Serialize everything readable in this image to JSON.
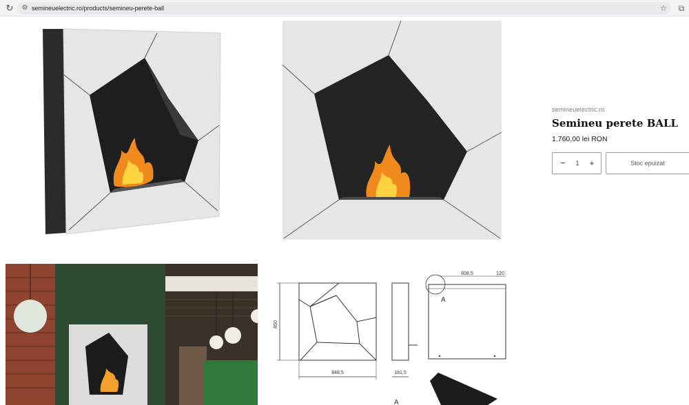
{
  "browser": {
    "url": "semineuelectric.ro/products/semineu-perete-ball",
    "reload_icon": "reload-icon",
    "site_info_icon": "tune-icon",
    "bookmark_icon": "star-icon",
    "extensions_icon": "puzzle-icon"
  },
  "gallery": {
    "images": [
      {
        "name": "fireplace-angled-view"
      },
      {
        "name": "fireplace-front-view"
      },
      {
        "name": "fireplace-interior-scenes"
      },
      {
        "name": "fireplace-technical-drawing"
      }
    ],
    "drawing": {
      "height_dim": "850",
      "width_dim": "848,5",
      "depth_dim": "181,5",
      "top_dim_1": "608,5",
      "top_dim_2": "120",
      "detail_label": "A",
      "detail_label_2": "A"
    }
  },
  "product": {
    "vendor": "semineuelectric.ro",
    "title": "Semineu perete BALL",
    "price": "1.760,00 lei RON",
    "quantity": "1",
    "minus_label": "−",
    "plus_label": "+",
    "soldout_label": "Stoc epuizat"
  },
  "colors": {
    "panel_white": "#e4e4e4",
    "dark_steel": "#2a2a2a",
    "flame_orange": "#f08a1c",
    "wall_green": "#2f4a33",
    "brick": "#9a4a30"
  }
}
